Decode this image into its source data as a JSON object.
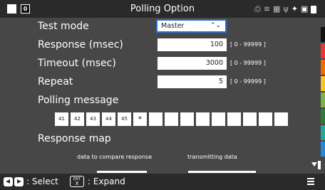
{
  "titlebar": {
    "title": "Polling Option",
    "left_badge": "0",
    "status_icons": [
      "printer-icon",
      "wifi-icon",
      "network-icon",
      "usb-icon",
      "wrench-icon",
      "sd-card-icon",
      "battery-icon"
    ]
  },
  "form": {
    "test_mode": {
      "label": "Test mode",
      "value": "Master"
    },
    "response": {
      "label": "Response (msec)",
      "value": "100",
      "range": "[ 0 - 99999 ]"
    },
    "timeout": {
      "label": "Timeout (msec)",
      "value": "3000",
      "range": "[ 0 - 99999 ]"
    },
    "repeat": {
      "label": "Repeat",
      "value": "5",
      "range": "[ 0 - 99999 ]"
    }
  },
  "polling": {
    "label": "Polling message",
    "bytes": [
      "41",
      "42",
      "43",
      "44",
      "45",
      "*",
      "",
      "",
      "",
      "",
      "",
      "",
      "",
      "",
      ""
    ]
  },
  "response_map": {
    "label": "Response map",
    "col1": "data to compare response",
    "col2": "transmitting data"
  },
  "colors": {
    "swatches": [
      "#111111",
      "#e53935",
      "#ef6c00",
      "#fbc02d",
      "#7cb342",
      "#2e7d32",
      "#26a69a",
      "#1e88e5",
      "#8e24aa",
      "#9e9e9e"
    ],
    "accent": "#2d6fd0",
    "background": "#474747"
  },
  "footer": {
    "select_text": ": Select",
    "expand_text": ": Expand",
    "enter_key_top": "ENT",
    "enter_key_bottom": "X"
  }
}
